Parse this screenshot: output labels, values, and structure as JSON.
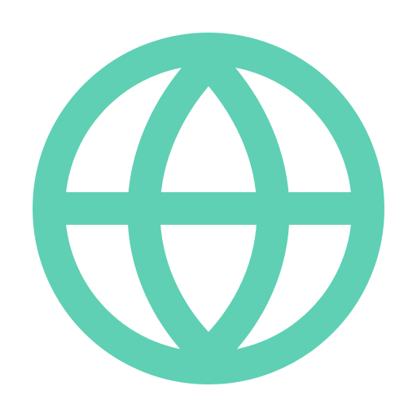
{
  "icon": {
    "name": "globe-icon",
    "color": "#5FD0B3"
  },
  "background": {
    "color": "#ffffff"
  }
}
